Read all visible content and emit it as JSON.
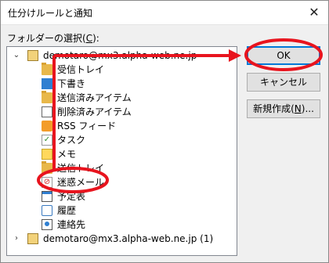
{
  "window": {
    "title": "仕分けルールと通知",
    "close_glyph": "✕"
  },
  "folder_select": {
    "label_prefix": "フォルダーの選択(",
    "label_accel": "C",
    "label_suffix": "):"
  },
  "tree": {
    "account_1": "demotaro@mx3.alpha-web.ne.jp",
    "folders": [
      {
        "label": "受信トレイ",
        "icon": "folder-icon"
      },
      {
        "label": "下書き",
        "icon": "draft-icon"
      },
      {
        "label": "送信済みアイテム",
        "icon": "folder-icon"
      },
      {
        "label": "削除済みアイテム",
        "icon": "trash-icon"
      },
      {
        "label": "RSS フィード",
        "icon": "rss-icon"
      },
      {
        "label": "タスク",
        "icon": "task-icon"
      },
      {
        "label": "メモ",
        "icon": "note-icon"
      },
      {
        "label": "送信トレイ",
        "icon": "folder-icon"
      },
      {
        "label": "迷惑メール",
        "icon": "junk-icon"
      },
      {
        "label": "予定表",
        "icon": "calendar-icon"
      },
      {
        "label": "履歴",
        "icon": "history-icon"
      },
      {
        "label": "連絡先",
        "icon": "contacts-icon"
      }
    ],
    "account_2": "demotaro@mx3.alpha-web.ne.jp (1)",
    "expand_glyph_open": "⌄",
    "expand_glyph_closed": "›"
  },
  "buttons": {
    "ok": "OK",
    "cancel": "キャンセル",
    "new_prefix": "新規作成(",
    "new_accel": "N",
    "new_suffix": ")..."
  },
  "annotation": {
    "color": "#e8141e"
  }
}
